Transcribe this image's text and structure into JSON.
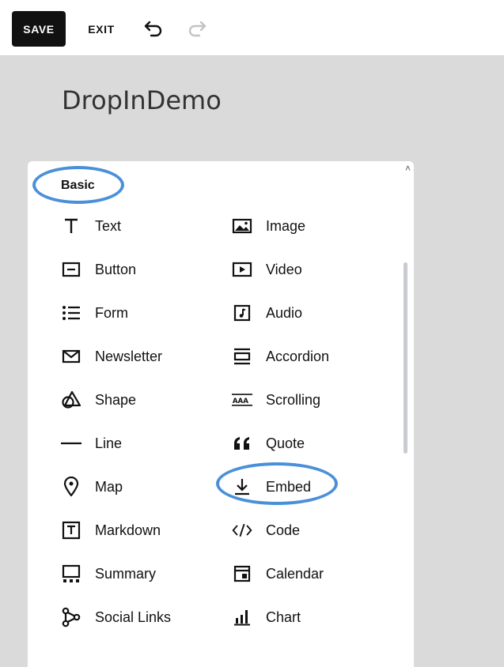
{
  "toolbar": {
    "save_label": "SAVE",
    "exit_label": "EXIT"
  },
  "page": {
    "title": "DropInDemo"
  },
  "panel": {
    "section_title": "Basic",
    "left_items": [
      {
        "label": "Text",
        "icon": "text-icon"
      },
      {
        "label": "Button",
        "icon": "button-icon"
      },
      {
        "label": "Form",
        "icon": "form-icon"
      },
      {
        "label": "Newsletter",
        "icon": "newsletter-icon"
      },
      {
        "label": "Shape",
        "icon": "shape-icon"
      },
      {
        "label": "Line",
        "icon": "line-icon"
      },
      {
        "label": "Map",
        "icon": "map-icon"
      },
      {
        "label": "Markdown",
        "icon": "markdown-icon"
      },
      {
        "label": "Summary",
        "icon": "summary-icon"
      },
      {
        "label": "Social Links",
        "icon": "social-links-icon"
      }
    ],
    "right_items": [
      {
        "label": "Image",
        "icon": "image-icon"
      },
      {
        "label": "Video",
        "icon": "video-icon"
      },
      {
        "label": "Audio",
        "icon": "audio-icon"
      },
      {
        "label": "Accordion",
        "icon": "accordion-icon"
      },
      {
        "label": "Scrolling",
        "icon": "scrolling-icon"
      },
      {
        "label": "Quote",
        "icon": "quote-icon"
      },
      {
        "label": "Embed",
        "icon": "embed-icon"
      },
      {
        "label": "Code",
        "icon": "code-icon"
      },
      {
        "label": "Calendar",
        "icon": "calendar-icon"
      },
      {
        "label": "Chart",
        "icon": "chart-icon"
      }
    ],
    "highlighted": [
      "Basic",
      "Embed"
    ]
  },
  "colors": {
    "highlight": "#4a90d9",
    "background": "#dadada",
    "save_button": "#111111"
  }
}
